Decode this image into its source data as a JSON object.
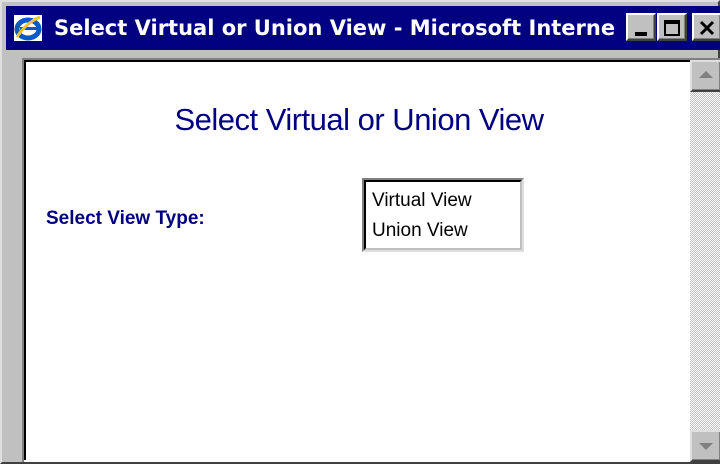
{
  "window": {
    "title": "Select Virtual or Union View - Microsoft Interne...",
    "titlebar_color": "#000080",
    "icon": "ie-icon",
    "controls": [
      "minimize-icon",
      "maximize-icon",
      "close-icon"
    ]
  },
  "page": {
    "heading": "Select Virtual or Union View",
    "field_label": "Select View Type:",
    "text_color": "#000080",
    "view_type_options": [
      "Virtual View",
      "Union View"
    ]
  },
  "scrollbar": {
    "up_icon": "up-arrow-icon",
    "down_icon": "down-arrow-icon"
  }
}
